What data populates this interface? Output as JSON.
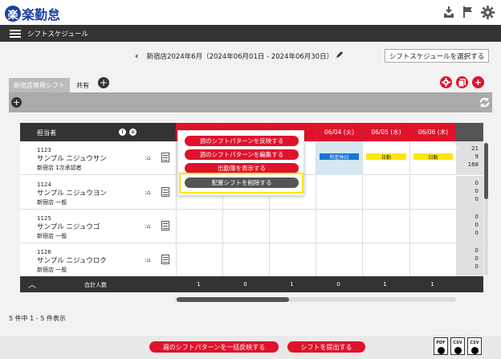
{
  "app": {
    "logo_mark": "楽",
    "logo_text": "楽勤怠"
  },
  "nav": {
    "title": "シフトスケジュール"
  },
  "period": {
    "prev": "‹",
    "text": "新宿店2024年6月（2024年06月01日 - 2024年06月30日）",
    "select_label": "シフトスケジュールを選択する"
  },
  "tabs": [
    {
      "label": "新宿店専用シフト"
    },
    {
      "label": "共有"
    }
  ],
  "table": {
    "header_label": "担当者",
    "dates": [
      "",
      "",
      "",
      "06/04 (火)",
      "06/05 (水)",
      "06/06 (木)"
    ],
    "rows": [
      {
        "id": "1123",
        "name": "サンプル ニジュウサン",
        "dept": "新宿店 1次承認者",
        "sum": [
          "21",
          "9",
          "168"
        ]
      },
      {
        "id": "1124",
        "name": "サンプル ニジュウヨン",
        "dept": "新宿店 一般",
        "sum": [
          "0",
          "0",
          "0"
        ]
      },
      {
        "id": "1125",
        "name": "サンプル ニジュウゴ",
        "dept": "新宿店 一般",
        "sum": [
          "0",
          "0",
          "0"
        ]
      },
      {
        "id": "1126",
        "name": "サンプル ニジュウロク",
        "dept": "新宿店 一般",
        "sum": [
          "0",
          "0",
          "0"
        ]
      }
    ],
    "row1_cells": [
      "所定休日",
      "日勤",
      "日勤"
    ],
    "footer_label": "合計人数",
    "footer_values": [
      "1",
      "0",
      "1",
      "0",
      "1",
      "1"
    ]
  },
  "popup": {
    "items": [
      "週のシフトパターンを反映する",
      "週のシフトパターンを編集する",
      "出勤簿を表示する",
      "配置シフトを削除する"
    ]
  },
  "count_text": "5 件中 1 - 5 件表示",
  "bottom": {
    "reflect_all": "週のシフトパターンを一括反映する",
    "submit": "シフトを提出する",
    "downloads": [
      "PDF",
      "CSV",
      "CSV"
    ]
  },
  "colors": {
    "accent": "#e0122b",
    "brand": "#1a3fa3",
    "highlight": "#ffe600",
    "holiday": "#1976d2"
  }
}
